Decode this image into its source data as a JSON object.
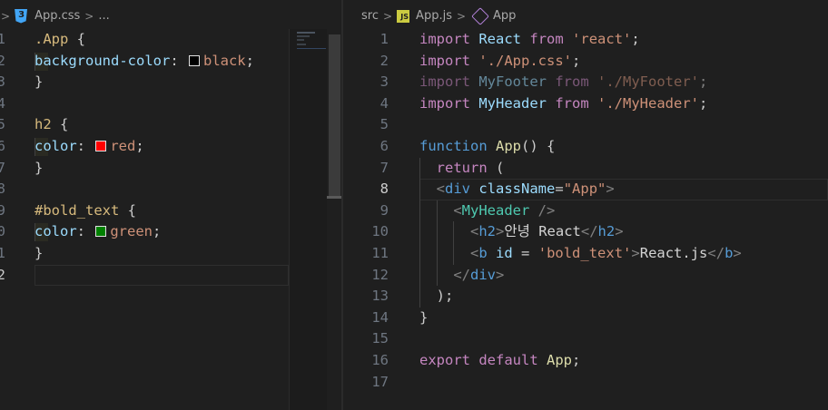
{
  "left": {
    "breadcrumb": {
      "file": "App.css",
      "more": "..."
    },
    "lines": [
      {
        "n": "1",
        "html": "<span class='sel'>.App</span> <span class='punc'>{</span>"
      },
      {
        "n": "2",
        "indent": true,
        "html": "<span class='prop'>background-color</span><span class='punc'>: </span><span class='swatch' style='background:#000000'></span><span class='val'>black</span><span class='punc'>;</span>"
      },
      {
        "n": "3",
        "html": "<span class='punc'>}</span>"
      },
      {
        "n": "4",
        "html": ""
      },
      {
        "n": "5",
        "html": "<span class='sel'>h2</span> <span class='punc'>{</span>"
      },
      {
        "n": "6",
        "indent": true,
        "html": "<span class='prop'>color</span><span class='punc'>: </span><span class='swatch' style='background:#ff0000'></span><span class='val'>red</span><span class='punc'>;</span>"
      },
      {
        "n": "7",
        "html": "<span class='punc'>}</span>"
      },
      {
        "n": "8",
        "html": ""
      },
      {
        "n": "9",
        "html": "<span class='sel'>#bold_text</span> <span class='punc'>{</span>"
      },
      {
        "n": "0",
        "indent": true,
        "html": "<span class='prop'>color</span><span class='punc'>: </span><span class='swatch' style='background:#008000'></span><span class='val'>green</span><span class='punc'>;</span>"
      },
      {
        "n": "1",
        "html": "<span class='punc'>}</span>"
      },
      {
        "n": "2",
        "active": true,
        "html": ""
      }
    ]
  },
  "right": {
    "breadcrumb": {
      "folder": "src",
      "file": "App.js",
      "symbol": "App"
    },
    "lines": [
      {
        "n": "1",
        "html": "<span class='kw'>import</span> <span class='var'>React</span> <span class='kw'>from</span> <span class='str'>'react'</span><span class='punc'>;</span>"
      },
      {
        "n": "2",
        "html": "<span class='kw'>import</span> <span class='str'>'./App.css'</span><span class='punc'>;</span>"
      },
      {
        "n": "3",
        "html": "<span class='dim'><span class='kw'>import</span> <span class='var'>MyFooter</span> <span class='kw'>from</span> <span class='str'>'./MyFooter'</span><span class='punc'>;</span></span>"
      },
      {
        "n": "4",
        "html": "<span class='kw'>import</span> <span class='var'>MyHeader</span> <span class='kw'>from</span> <span class='str'>'./MyHeader'</span><span class='punc'>;</span>"
      },
      {
        "n": "5",
        "html": ""
      },
      {
        "n": "6",
        "html": "<span class='kwb'>function</span> <span class='fn'>App</span><span class='punc'>() {</span>"
      },
      {
        "n": "7",
        "html": "  <span class='kw'>return</span> <span class='punc'>(</span>"
      },
      {
        "n": "8",
        "active": true,
        "html": "  <span class='gray'>&lt;</span><span class='tag'>div</span> <span class='attr'>className</span><span class='punc'>=</span><span class='str'>\"App\"</span><span class='gray'>&gt;</span>"
      },
      {
        "n": "9",
        "html": "    <span class='gray'>&lt;</span><span class='comp'>MyHeader</span> <span class='gray'>/&gt;</span>"
      },
      {
        "n": "10",
        "html": "      <span class='gray'>&lt;</span><span class='tag'>h2</span><span class='gray'>&gt;</span><span class='txtc'>안녕 React</span><span class='gray'>&lt;/</span><span class='tag'>h2</span><span class='gray'>&gt;</span>"
      },
      {
        "n": "11",
        "html": "      <span class='gray'>&lt;</span><span class='tag'>b</span> <span class='attr'>id</span> <span class='punc'>=</span> <span class='str'>'bold_text'</span><span class='gray'>&gt;</span><span class='txtc'>React.js</span><span class='gray'>&lt;/</span><span class='tag'>b</span><span class='gray'>&gt;</span>"
      },
      {
        "n": "12",
        "html": "    <span class='gray'>&lt;/</span><span class='tag'>div</span><span class='gray'>&gt;</span>"
      },
      {
        "n": "13",
        "html": "  <span class='punc'>);</span>"
      },
      {
        "n": "14",
        "html": "<span class='punc'>}</span>"
      },
      {
        "n": "15",
        "html": ""
      },
      {
        "n": "16",
        "html": "<span class='kw'>export</span> <span class='kw'>default</span> <span class='fn'>App</span><span class='punc'>;</span>"
      },
      {
        "n": "17",
        "html": ""
      }
    ]
  }
}
